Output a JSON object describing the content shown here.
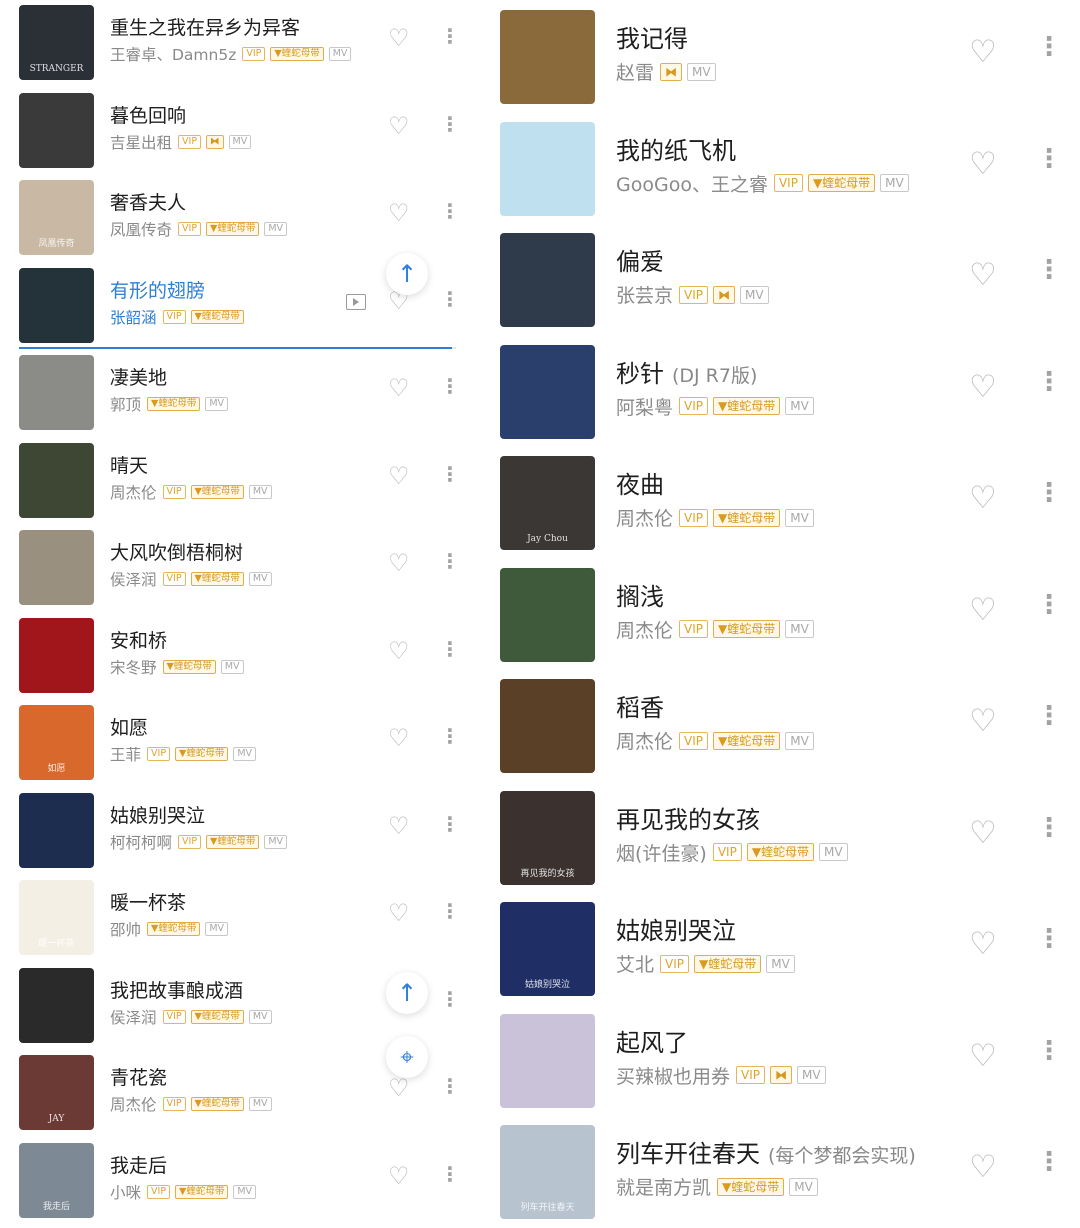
{
  "badges": {
    "vip": "VIP",
    "hq": "▼蝰蛇母带",
    "dolby": "⧓",
    "mv": "MV"
  },
  "icons": {
    "heart": "heart-icon",
    "more": "more-dots-icon",
    "mv_play": "mv-play-icon",
    "back_to_top": "arrow-up-icon",
    "locate": "locate-current-icon"
  },
  "colors": {
    "accent": "#2f7fd6",
    "vip_gold": "#e0a32a",
    "muted": "#8a8a8a"
  },
  "left_list": [
    {
      "title": "重生之我在异乡为异客",
      "artist": "王睿卓、Damn5z",
      "badges": [
        "vip",
        "hq",
        "mv"
      ],
      "cover_text": "STRANGER",
      "cover_color": "#2b2f36"
    },
    {
      "title": "暮色回响",
      "artist": "吉星出租",
      "badges": [
        "vip",
        "dolby",
        "mv"
      ],
      "cover_text": "",
      "cover_color": "#3a3a3a"
    },
    {
      "title": "奢香夫人",
      "artist": "凤凰传奇",
      "badges": [
        "vip",
        "hq",
        "mv"
      ],
      "cover_text": "凤凰传奇",
      "cover_color": "#c9b9a4"
    },
    {
      "title": "有形的翅膀",
      "artist": "张韶涵",
      "badges": [
        "vip",
        "hq"
      ],
      "cover_text": "",
      "cover_color": "#24333a",
      "playing": true,
      "progress": 0.99
    },
    {
      "title": "凄美地",
      "artist": "郭顶",
      "badges": [
        "hq",
        "mv"
      ],
      "cover_text": "",
      "cover_color": "#8b8b87"
    },
    {
      "title": "晴天",
      "artist": "周杰伦",
      "badges": [
        "vip",
        "hq",
        "mv"
      ],
      "cover_text": "",
      "cover_color": "#3d4734"
    },
    {
      "title": "大风吹倒梧桐树",
      "artist": "侯泽润",
      "badges": [
        "vip",
        "hq",
        "mv"
      ],
      "cover_text": "",
      "cover_color": "#9a9080"
    },
    {
      "title": "安和桥",
      "artist": "宋冬野",
      "badges": [
        "hq",
        "mv"
      ],
      "cover_text": "",
      "cover_color": "#a0161b"
    },
    {
      "title": "如愿",
      "artist": "王菲",
      "badges": [
        "vip",
        "hq",
        "mv"
      ],
      "cover_text": "如愿",
      "cover_color": "#d9682c"
    },
    {
      "title": "姑娘别哭泣",
      "artist": "柯柯柯啊",
      "badges": [
        "vip",
        "hq",
        "mv"
      ],
      "cover_text": "",
      "cover_color": "#1c2d4f"
    },
    {
      "title": "暖一杯茶",
      "artist": "邵帅",
      "badges": [
        "hq",
        "mv"
      ],
      "cover_text": "暖一杯茶",
      "cover_color": "#f4efe4"
    },
    {
      "title": "我把故事酿成酒",
      "artist": "侯泽润",
      "badges": [
        "vip",
        "hq",
        "mv"
      ],
      "cover_text": "",
      "cover_color": "#2a2a2a"
    },
    {
      "title": "青花瓷",
      "artist": "周杰伦",
      "badges": [
        "vip",
        "hq",
        "mv"
      ],
      "cover_text": "JAY",
      "cover_color": "#6b3a35"
    },
    {
      "title": "我走后",
      "artist": "小咪",
      "badges": [
        "vip",
        "hq",
        "mv"
      ],
      "cover_text": "我走后",
      "cover_color": "#7d8a96"
    }
  ],
  "right_list": [
    {
      "title": "我记得",
      "note": "",
      "artist": "赵雷",
      "badges": [
        "dolby",
        "mv"
      ],
      "cover_text": "",
      "cover_color": "#8a6a3a"
    },
    {
      "title": "我的纸飞机",
      "note": "",
      "artist": "GooGoo、王之睿",
      "badges": [
        "vip",
        "hq",
        "mv"
      ],
      "cover_text": "",
      "cover_color": "#bfe0ef"
    },
    {
      "title": "偏爱",
      "note": "",
      "artist": "张芸京",
      "badges": [
        "vip",
        "dolby",
        "mv"
      ],
      "cover_text": "",
      "cover_color": "#2f3a4a"
    },
    {
      "title": "秒针",
      "note": "(DJ R7版)",
      "artist": "阿梨粤",
      "badges": [
        "vip",
        "hq",
        "mv"
      ],
      "cover_text": "",
      "cover_color": "#2a3f6b"
    },
    {
      "title": "夜曲",
      "note": "",
      "artist": "周杰伦",
      "badges": [
        "vip",
        "hq",
        "mv"
      ],
      "cover_text": "Jay Chou",
      "cover_color": "#3a3734"
    },
    {
      "title": "搁浅",
      "note": "",
      "artist": "周杰伦",
      "badges": [
        "vip",
        "hq",
        "mv"
      ],
      "cover_text": "",
      "cover_color": "#3f5a3a"
    },
    {
      "title": "稻香",
      "note": "",
      "artist": "周杰伦",
      "badges": [
        "vip",
        "hq",
        "mv"
      ],
      "cover_text": "",
      "cover_color": "#5a4027"
    },
    {
      "title": "再见我的女孩",
      "note": "",
      "artist": "烟(许佳豪)",
      "badges": [
        "vip",
        "hq",
        "mv"
      ],
      "cover_text": "再见我的女孩",
      "cover_color": "#3b3230"
    },
    {
      "title": "姑娘别哭泣",
      "note": "",
      "artist": "艾北",
      "badges": [
        "vip",
        "hq",
        "mv"
      ],
      "cover_text": "姑娘别哭泣",
      "cover_color": "#1f2f66"
    },
    {
      "title": "起风了",
      "note": "",
      "artist": "买辣椒也用券",
      "badges": [
        "vip",
        "dolby",
        "mv"
      ],
      "cover_text": "",
      "cover_color": "#c9c2d9"
    },
    {
      "title": "列车开往春天",
      "note": "(每个梦都会实现)",
      "artist": "就是南方凯",
      "badges": [
        "hq",
        "mv"
      ],
      "cover_text": "列车开往春天",
      "cover_color": "#b7c3cf"
    }
  ]
}
